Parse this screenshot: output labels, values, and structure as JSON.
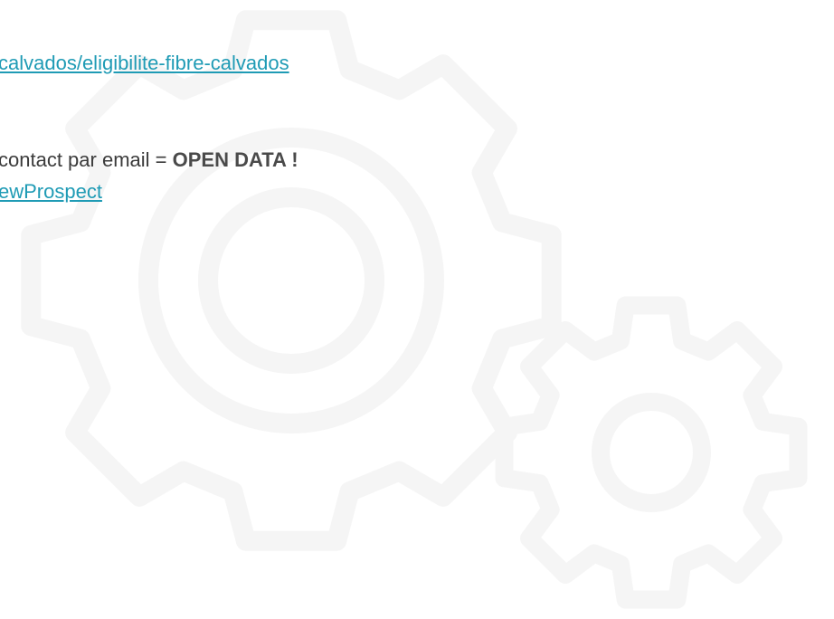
{
  "links": {
    "calvados_url": "calvados/eligibilite-fibre-calvados",
    "new_prospect": "ewProspect"
  },
  "contact_line": {
    "prefix": "contact par email = ",
    "emphasis": "OPEN DATA !"
  },
  "colors": {
    "link": "#1f9bb5",
    "text": "#3b3b3b",
    "watermark": "#f5f5f5"
  },
  "icons": {
    "large_watermark": "gear-icon",
    "small_watermark": "gear-icon"
  }
}
